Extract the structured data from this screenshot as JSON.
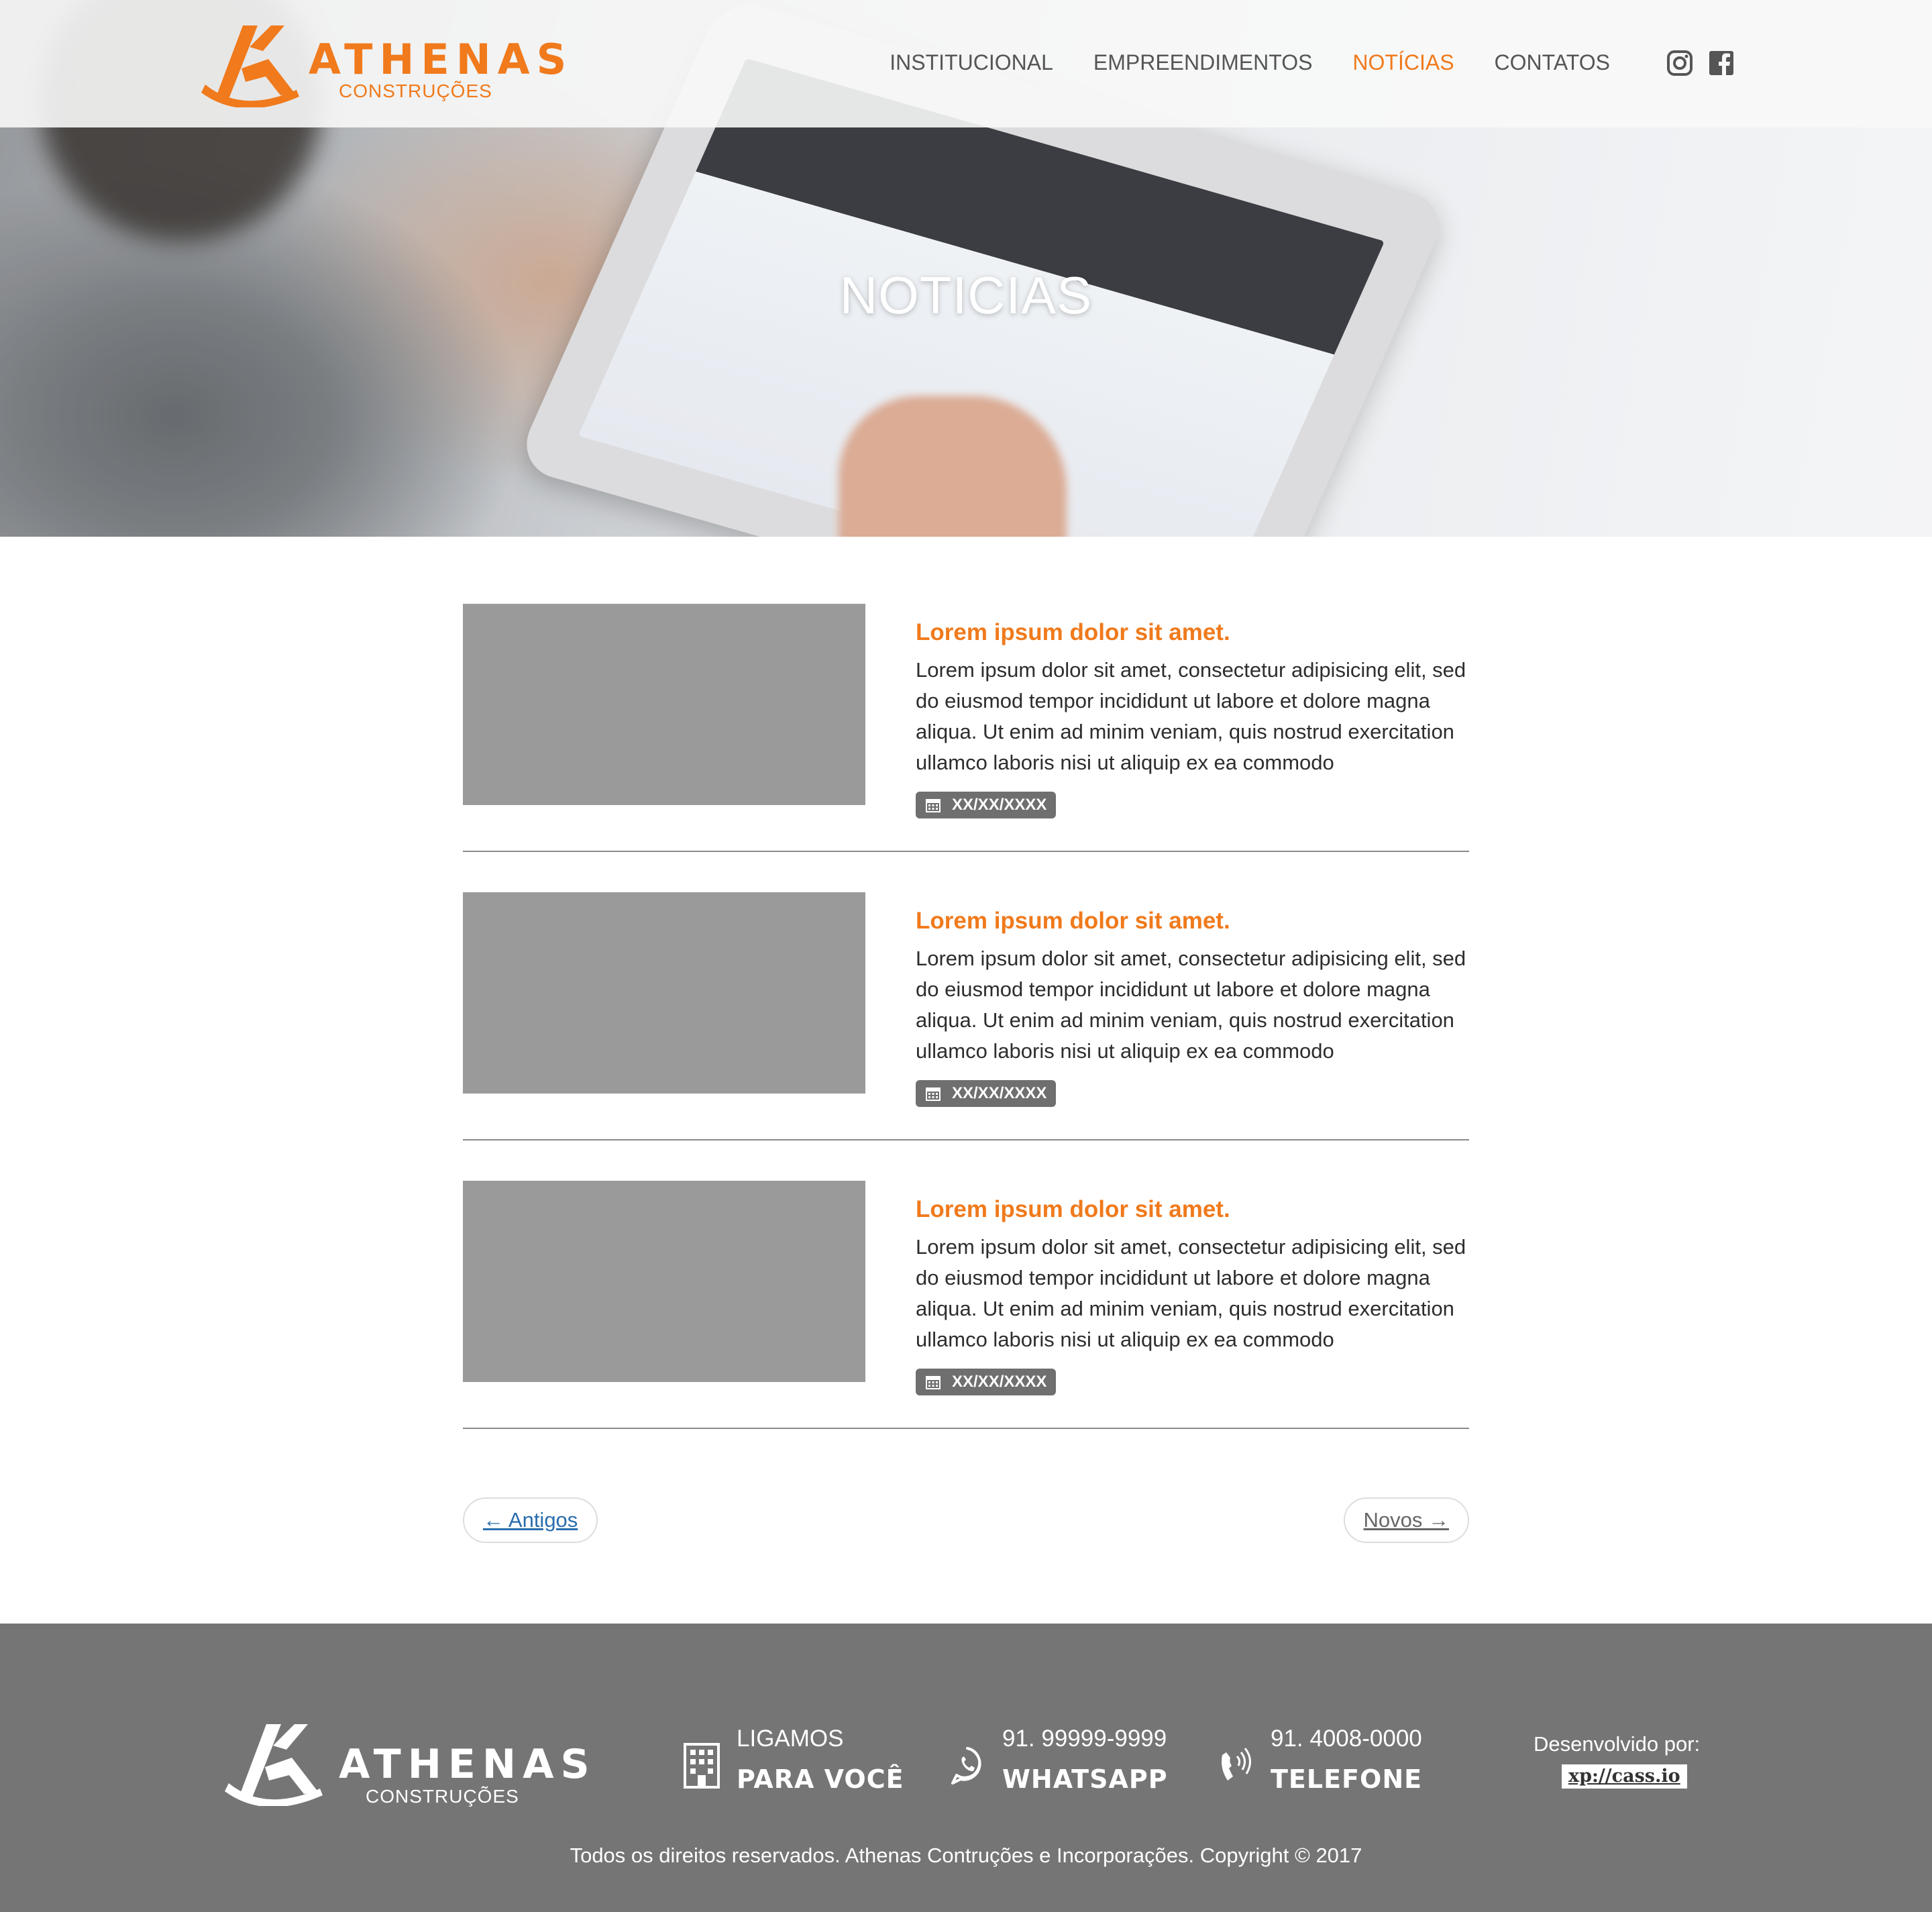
{
  "colors": {
    "accent": "#f07a1c",
    "footer_bg": "#757575",
    "thumb": "#9a9a9a",
    "badge": "#6f6f6f"
  },
  "header": {
    "logo": {
      "name": "ATHENAS",
      "sub": "CONSTRUÇÕES"
    },
    "nav": [
      {
        "label": "INSTITUCIONAL",
        "active": false
      },
      {
        "label": "EMPREENDIMENTOS",
        "active": false
      },
      {
        "label": "NOTÍCIAS",
        "active": true
      },
      {
        "label": "CONTATOS",
        "active": false
      }
    ],
    "social_icons": [
      "instagram-icon",
      "facebook-icon"
    ]
  },
  "hero": {
    "title": "NOTICIAS"
  },
  "news": [
    {
      "title": "Lorem ipsum dolor sit amet.",
      "text": "Lorem ipsum dolor sit amet, consectetur adipisicing elit, sed do eiusmod tempor incididunt ut labore et dolore magna aliqua. Ut enim ad minim veniam, quis nostrud exercitation ullamco laboris nisi ut aliquip ex ea commodo",
      "date": "XX/XX/XXXX"
    },
    {
      "title": "Lorem ipsum dolor sit amet.",
      "text": "Lorem ipsum dolor sit amet, consectetur adipisicing elit, sed do eiusmod tempor incididunt ut labore et dolore magna aliqua. Ut enim ad minim veniam, quis nostrud exercitation ullamco laboris nisi ut aliquip ex ea commodo",
      "date": "XX/XX/XXXX"
    },
    {
      "title": "Lorem ipsum dolor sit amet.",
      "text": "Lorem ipsum dolor sit amet, consectetur adipisicing elit, sed do eiusmod tempor incididunt ut labore et dolore magna aliqua. Ut enim ad minim veniam, quis nostrud exercitation ullamco laboris nisi ut aliquip ex ea commodo",
      "date": "XX/XX/XXXX"
    }
  ],
  "pager": {
    "older": "← Antigos",
    "newer": "Novos →"
  },
  "footer": {
    "logo": {
      "name": "ATHENAS",
      "sub": "CONSTRUÇÕES"
    },
    "contacts": [
      {
        "icon": "building-icon",
        "line1": "LIGAMOS",
        "line2": "PARA VOCÊ"
      },
      {
        "icon": "whatsapp-icon",
        "line1": "91. 99999-9999",
        "line2": "WHATSAPP"
      },
      {
        "icon": "phone-icon",
        "line1": "91. 4008-0000",
        "line2": "TELEFONE"
      }
    ],
    "developer": {
      "label": "Desenvolvido por:",
      "name": "xp://cass.io"
    },
    "copyright": "Todos os direitos reservados. Athenas Contruções e Incorporações. Copyright © 2017"
  }
}
